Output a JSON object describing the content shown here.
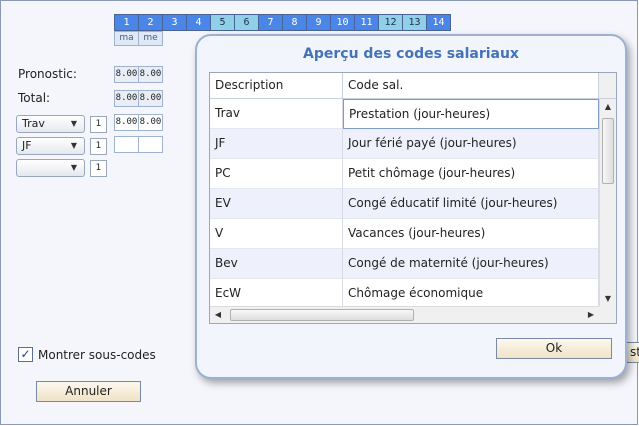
{
  "calendar": {
    "days": [
      {
        "num": "1",
        "weekend": false
      },
      {
        "num": "2",
        "weekend": false
      },
      {
        "num": "3",
        "weekend": false
      },
      {
        "num": "4",
        "weekend": false
      },
      {
        "num": "5",
        "weekend": true
      },
      {
        "num": "6",
        "weekend": true
      },
      {
        "num": "7",
        "weekend": false
      },
      {
        "num": "8",
        "weekend": false
      },
      {
        "num": "9",
        "weekend": false
      },
      {
        "num": "10",
        "weekend": false
      },
      {
        "num": "11",
        "weekend": false
      },
      {
        "num": "12",
        "weekend": true
      },
      {
        "num": "13",
        "weekend": true
      },
      {
        "num": "14",
        "weekend": false
      }
    ],
    "weekdays": [
      "ma",
      "me"
    ]
  },
  "summary": {
    "pronostic_label": "Pronostic:",
    "total_label": "Total:",
    "pronostic_values": [
      "8.00",
      "8.00"
    ],
    "total_values": [
      "8.00",
      "8.00"
    ]
  },
  "code_rows": [
    {
      "code": "Trav",
      "qty": "1",
      "values": [
        "8.00",
        "8.00"
      ]
    },
    {
      "code": "JF",
      "qty": "1",
      "values": [
        "",
        ""
      ]
    },
    {
      "code": "",
      "qty": "1",
      "values": []
    }
  ],
  "show_subcodes": {
    "label": "Montrer sous-codes",
    "checked": true,
    "mark": "✓"
  },
  "cancel_label": "Annuler",
  "hidden_button_partial": "st",
  "modal": {
    "title": "Aperçu des codes salariaux",
    "columns": {
      "description": "Description",
      "code": "Code sal."
    },
    "rows": [
      {
        "description": "Trav",
        "code": "Prestation (jour-heures)"
      },
      {
        "description": "JF",
        "code": "Jour férié payé (jour-heures)"
      },
      {
        "description": "PC",
        "code": "Petit chômage (jour-heures)"
      },
      {
        "description": "EV",
        "code": "Congé éducatif limité (jour-heures)"
      },
      {
        "description": "V",
        "code": "Vacances (jour-heures)"
      },
      {
        "description": "Bev",
        "code": "Congé de maternité (jour-heures)"
      },
      {
        "description": "EcW",
        "code": "Chômage économique"
      }
    ],
    "ok_label": "Ok"
  },
  "icons": {
    "dropdown": "▼",
    "scroll_up": "▲",
    "scroll_down": "▼",
    "scroll_left": "◀",
    "scroll_right": "▶"
  },
  "colors": {
    "day_header": "#4a86e8",
    "weekend_header": "#8fd0e6",
    "modal_title": "#4573b8",
    "selected_row": "#eef1fc"
  }
}
